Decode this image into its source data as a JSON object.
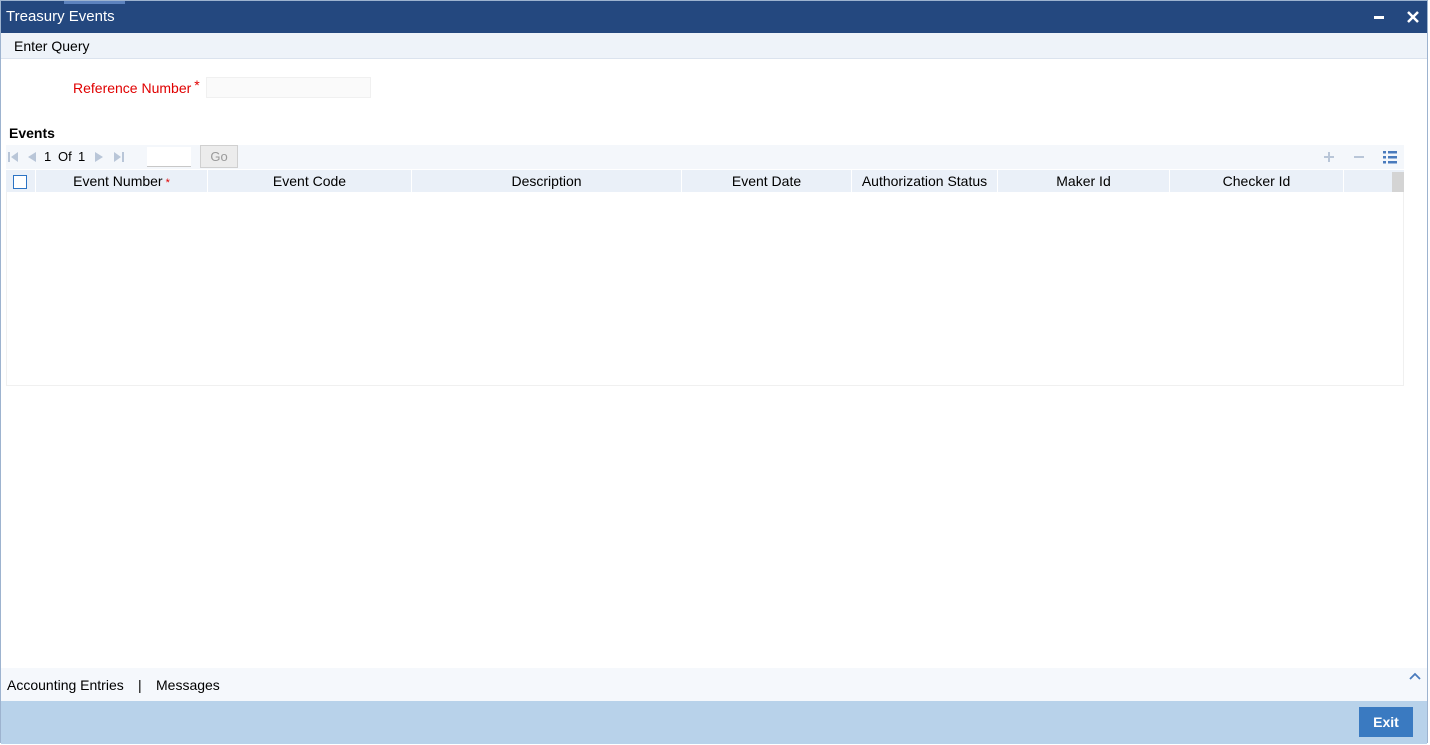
{
  "window": {
    "title": "Treasury Events",
    "minimize_icon": "minimize-icon",
    "close_icon": "close-icon"
  },
  "menu": {
    "items": [
      {
        "label": "Enter Query"
      }
    ]
  },
  "form": {
    "reference_number": {
      "label": "Reference Number",
      "required_mark": "*",
      "value": ""
    }
  },
  "events": {
    "section_title": "Events",
    "pager": {
      "current_page": "1",
      "of_label": "Of",
      "total_pages": "1",
      "page_input_value": "",
      "go_label": "Go"
    },
    "toolbar_icons": [
      "add-row-icon",
      "delete-row-icon",
      "single-view-icon"
    ],
    "columns": [
      {
        "label": "Event Number",
        "required": true
      },
      {
        "label": "Event Code"
      },
      {
        "label": "Description"
      },
      {
        "label": "Event Date"
      },
      {
        "label": "Authorization Status"
      },
      {
        "label": "Maker Id"
      },
      {
        "label": "Checker Id"
      }
    ],
    "required_dot": "*",
    "rows": []
  },
  "footer": {
    "links": [
      {
        "label": "Accounting Entries"
      },
      {
        "label": "Messages"
      }
    ],
    "separator": "|",
    "exit_label": "Exit"
  },
  "colors": {
    "titlebar": "#24487f",
    "required": "#e00000",
    "exit_button": "#3a7ac1",
    "footer_bar": "#b8d2ea"
  }
}
